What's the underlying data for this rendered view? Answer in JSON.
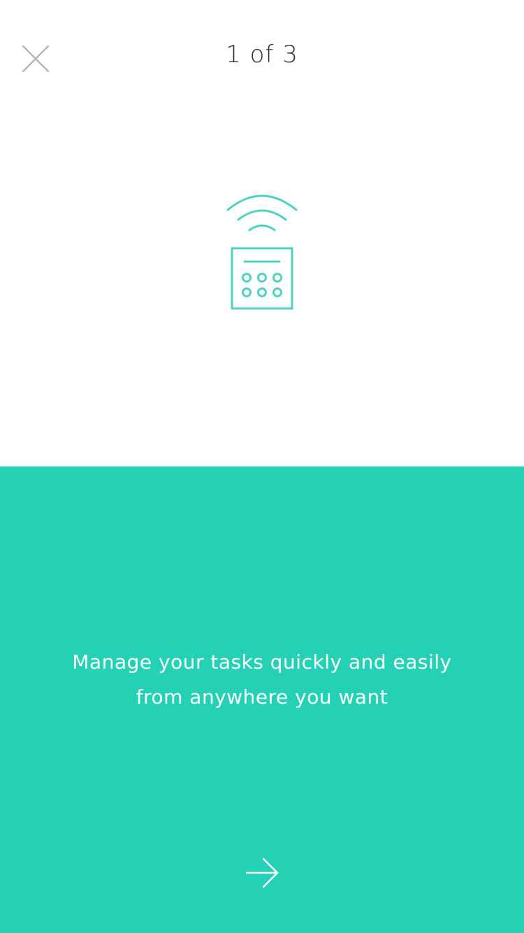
{
  "header": {
    "close_icon": "close-icon",
    "page_counter": "1 of 3"
  },
  "illustration": {
    "icon": "remote-control-wifi-icon"
  },
  "content": {
    "tagline_line1": "Manage your tasks quickly and easily",
    "tagline_line2": "from anywhere you want"
  },
  "footer": {
    "next_icon": "arrow-right-icon"
  },
  "colors": {
    "accent": "#25d1b5",
    "icon_stroke": "#4fd2c0",
    "text_dark": "#2a2f33",
    "close_icon": "#b5b5b5",
    "text_light": "#ffffff"
  }
}
